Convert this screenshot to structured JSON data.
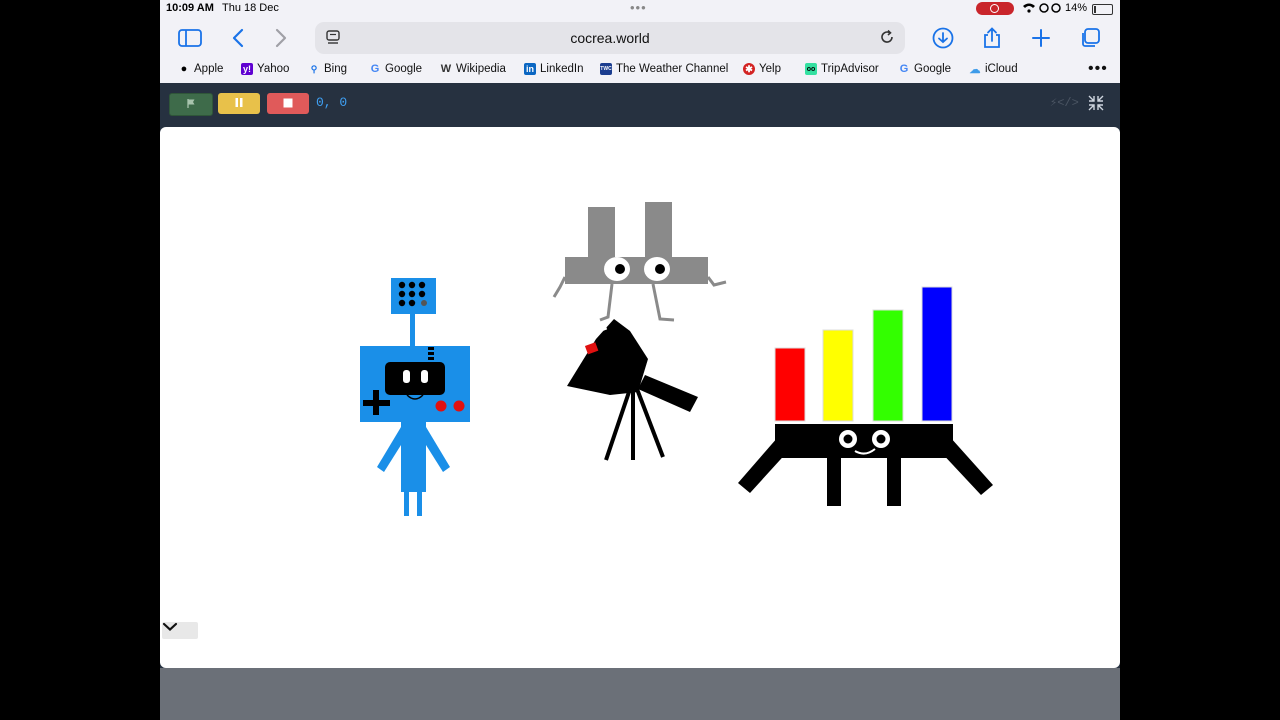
{
  "status_bar": {
    "time": "10:09 AM",
    "date": "Thu 18 Dec",
    "battery": "14%",
    "battery_level": 0.14
  },
  "toolbar": {
    "url": "cocrea.world"
  },
  "bookmarks": [
    {
      "label": "Apple",
      "icon": "apple-icon",
      "color": "#000000"
    },
    {
      "label": "Yahoo",
      "icon": "yahoo-icon",
      "color": "#5f01d1"
    },
    {
      "label": "Bing",
      "icon": "search-icon",
      "color": "#1a73e8"
    },
    {
      "label": "Google",
      "icon": "google-icon",
      "color": "#4285f4"
    },
    {
      "label": "Wikipedia",
      "icon": "wikipedia-icon",
      "color": "#333333"
    },
    {
      "label": "LinkedIn",
      "icon": "linkedin-icon",
      "color": "#0a66c2"
    },
    {
      "label": "The Weather Channel",
      "icon": "weather-channel-icon",
      "color": "#1b3d8f"
    },
    {
      "label": "Yelp",
      "icon": "yelp-icon",
      "color": "#d32323"
    },
    {
      "label": "TripAdvisor",
      "icon": "tripadvisor-icon",
      "color": "#34e0a1"
    },
    {
      "label": "Google",
      "icon": "google-icon",
      "color": "#4285f4"
    },
    {
      "label": "iCloud",
      "icon": "icloud-icon",
      "color": "#3d9be9"
    }
  ],
  "editor": {
    "coords": "0, 0",
    "colors": {
      "flag": "#3e6b4a",
      "pause": "#e8c14a",
      "stop": "#e05a5a",
      "coords": "#3fa1f5",
      "frame": "#263140"
    }
  },
  "stage": {
    "characters": [
      {
        "name": "game-console-robot",
        "color": "#1a8fe8"
      },
      {
        "name": "gray-letter-character",
        "color": "#8a8a8a"
      },
      {
        "name": "movie-camera",
        "color": "#000000"
      },
      {
        "name": "bar-chart-creature",
        "bar_colors": [
          "#ff0000",
          "#ffff00",
          "#33ff00",
          "#0000ff"
        ]
      }
    ]
  }
}
